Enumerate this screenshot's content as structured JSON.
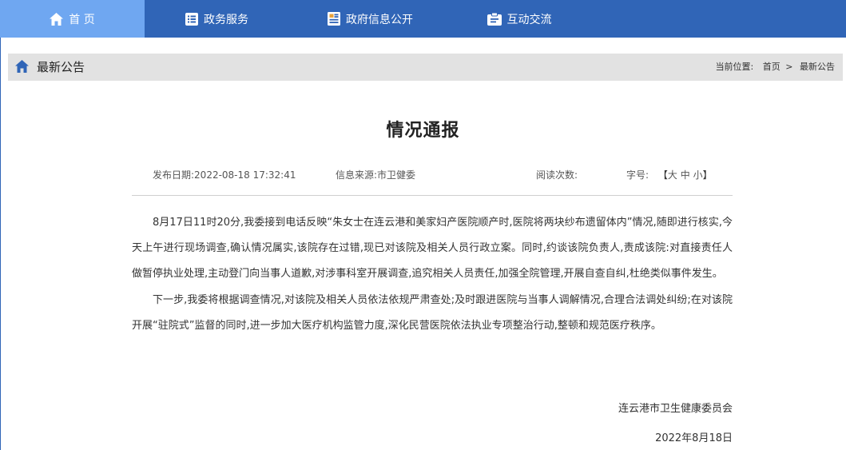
{
  "nav": {
    "items": [
      {
        "label": "首 页",
        "icon": "home-icon"
      },
      {
        "label": "政务服务",
        "icon": "list-icon"
      },
      {
        "label": "政府信息公开",
        "icon": "document-icon"
      },
      {
        "label": "互动交流",
        "icon": "chat-icon"
      }
    ]
  },
  "section": {
    "title": "最新公告",
    "breadcrumb_prefix": "当前位置:",
    "breadcrumb_home": "首页",
    "breadcrumb_sep": ">",
    "breadcrumb_current": "最新公告"
  },
  "article": {
    "title": "情况通报",
    "publish_date": "发布日期:2022-08-18 17:32:41",
    "source": "信息来源:市卫健委",
    "views": "阅读次数:",
    "font_size_label": "字号:",
    "font_size_open": "【",
    "font_large": "大",
    "font_medium": "中",
    "font_small": "小",
    "font_size_close": "】",
    "paragraphs": [
      "8月17日11时20分,我委接到电话反映“朱女士在连云港和美家妇产医院顺产时,医院将两块纱布遗留体内”情况,随即进行核实,今天上午进行现场调查,确认情况属实,该院存在过错,现已对该院及相关人员行政立案。同时,约谈该院负责人,责成该院:对直接责任人做暂停执业处理,主动登门向当事人道歉,对涉事科室开展调查,追究相关人员责任,加强全院管理,开展自查自纠,杜绝类似事件发生。",
      "下一步,我委将根据调查情况,对该院及相关人员依法依规严肃查处;及时跟进医院与当事人调解情况,合理合法调处纠纷;在对该院开展“驻院式”监督的同时,进一步加大医疗机构监管力度,深化民营医院依法执业专项整治行动,整顿和规范医疗秩序。"
    ],
    "signature": "连云港市卫生健康委员会",
    "date": "2022年8月18日"
  }
}
